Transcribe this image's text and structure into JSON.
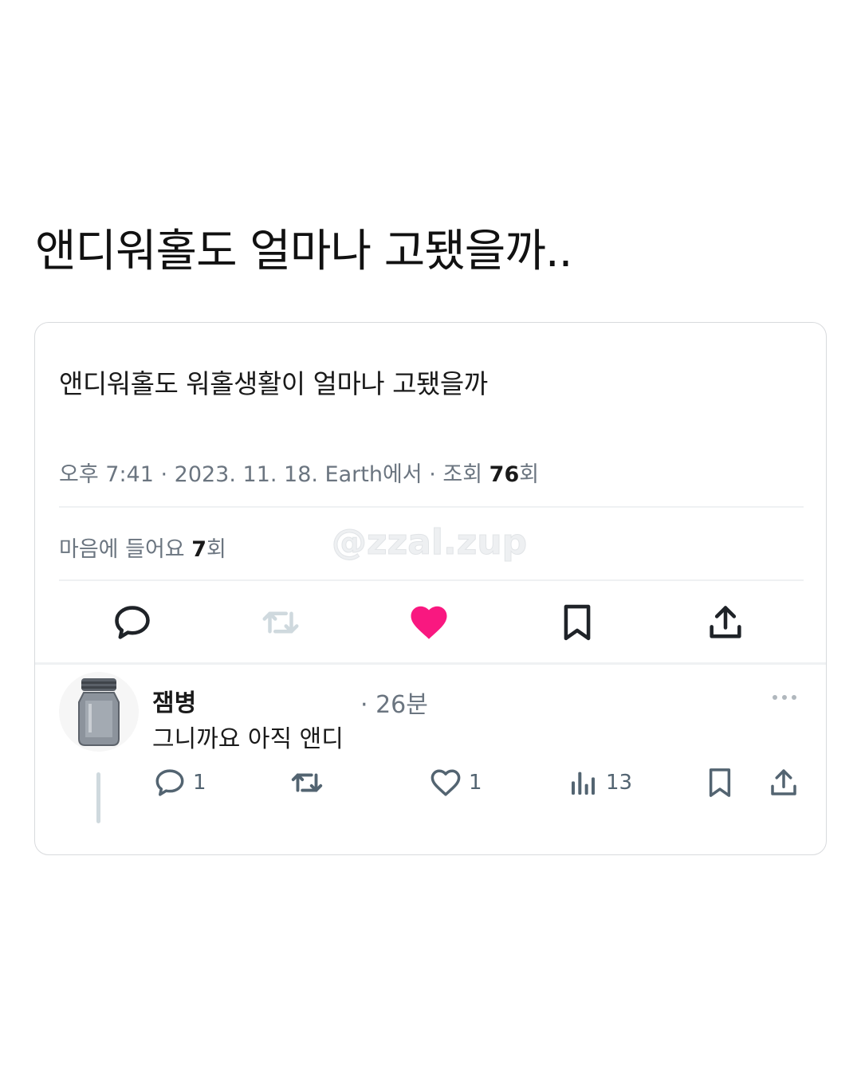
{
  "post": {
    "headline": "앤디워홀도 얼마나 고됐을까.."
  },
  "tweet": {
    "text": "앤디워홀도 워홀생활이 얼마나 고됐을까",
    "meta_prefix": "오후 7:41 · 2023. 11. 18. Earth에서 · 조회 ",
    "views": "76",
    "views_suffix": "회",
    "likes_prefix": "마음에 들어요 ",
    "likes": "7",
    "likes_suffix": "회",
    "watermark": "@zzal.zup",
    "actions": [
      "reply-icon",
      "retweet-icon",
      "like-icon",
      "bookmark-icon",
      "share-icon"
    ],
    "liked": true,
    "colors": {
      "like": "#f91880",
      "icon": "#536471",
      "disabled": "#cfd9de"
    }
  },
  "reply": {
    "name": "잼병",
    "time": "· 26분",
    "text": "그니까요 아직 앤디",
    "reply_count": "1",
    "like_count": "1",
    "view_count": "13"
  }
}
